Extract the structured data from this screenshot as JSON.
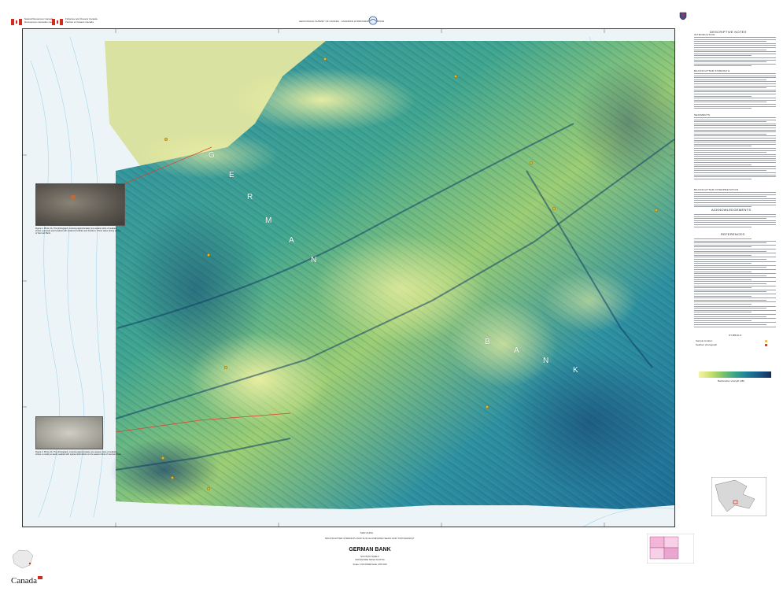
{
  "header": {
    "left_agency_1": "Natural Resources Canada",
    "left_agency_1_fr": "Ressources naturelles Canada",
    "left_agency_2": "Fisheries and Oceans Canada",
    "left_agency_2_fr": "Pêches et Océans Canada",
    "center_line": "GEOLOGICAL SURVEY OF CANADA · CANADIAN HYDROGRAPHIC SERVICE",
    "right_section": "DESCRIPTIVE NOTES"
  },
  "map": {
    "labels": {
      "g": "G",
      "e": "E",
      "r": "R",
      "m": "M",
      "a": "A",
      "n": "N",
      "b": "B",
      "a2": "A",
      "n2": "N",
      "k": "K"
    },
    "colors": {
      "shallow": "#f3f0a4",
      "mid_shallow": "#b9d96a",
      "mid": "#5fb38a",
      "deep": "#1f7f9a",
      "deepest": "#173a6a",
      "land": "#e9e6b8",
      "contour": "#8fd0e6",
      "sample_point": "#f0b81a",
      "cable": "#e0412b"
    },
    "photo_captions": {
      "top": "Figure 1. Photo 1A. The photograph, covering approximately one square metre of seabed, shows a gravelly sand seabed with scattered cobbles and boulders. Photo taken during survey of German Bank.",
      "bottom": "Figure 2. Photo 2A. The photograph, covering approximately one square metre of seabed, shows a muddy to sandy seabed with sparse shell debris on the eastern flank of German Bank."
    }
  },
  "right_column": {
    "section_1": "INTRODUCTION",
    "section_2": "BACKSCATTER STRENGTH",
    "section_3": "SEDIMENTS",
    "section_4": "BACKSCATTER INTERPRETATION",
    "section_5": "ACKNOWLEDGEMENTS",
    "section_6": "REFERENCES",
    "section_7": "SYMBOLS",
    "symbol_1": "Sample location",
    "symbol_2": "Seafloor photograph",
    "legend_label": "Backscatter strength (dB)"
  },
  "footer": {
    "map_number": "MAP 2146A",
    "series_title": "BACKSCATTER STRENGTH AND SUN-ILLUMINATED SEAFLOOR TOPOGRAPHY",
    "title": "GERMAN BANK",
    "subtitle_1": "SCOTIAN SHELF",
    "subtitle_2": "OFFSHORE NOVA SCOTIA",
    "scale": "Scale 1:50 000/Échelle 1/50 000",
    "canada_wordmark": "Canada"
  }
}
